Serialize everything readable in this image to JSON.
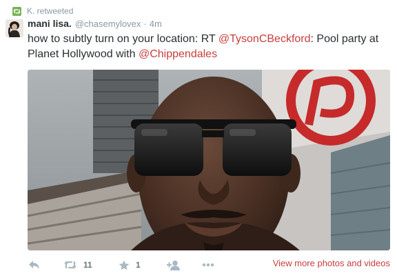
{
  "retweet_context": {
    "label": "K. retweeted",
    "icon": "retweet-icon"
  },
  "tweet": {
    "display_name": "mani lisa.",
    "handle": "@chasemylovex",
    "separator": "·",
    "time": "4m",
    "text_before": "how to subtly turn on your location: RT ",
    "mention_1": "@TysonCBeckford",
    "text_middle": ": Pool party at Planet Hollywood with ",
    "mention_2": "@Chippendales"
  },
  "actions": {
    "reply_icon": "reply-icon",
    "retweet_icon": "retweet-icon",
    "retweet_count": "11",
    "favorite_icon": "star-icon",
    "favorite_count": "1",
    "follow_icon": "add-user-icon",
    "more_icon": "more-icon",
    "view_more": "View more photos and videos"
  },
  "colors": {
    "link": "#c83d3d",
    "retweet_badge": "#77b255",
    "muted": "#8899a6",
    "action_icon": "#aab8c2"
  }
}
